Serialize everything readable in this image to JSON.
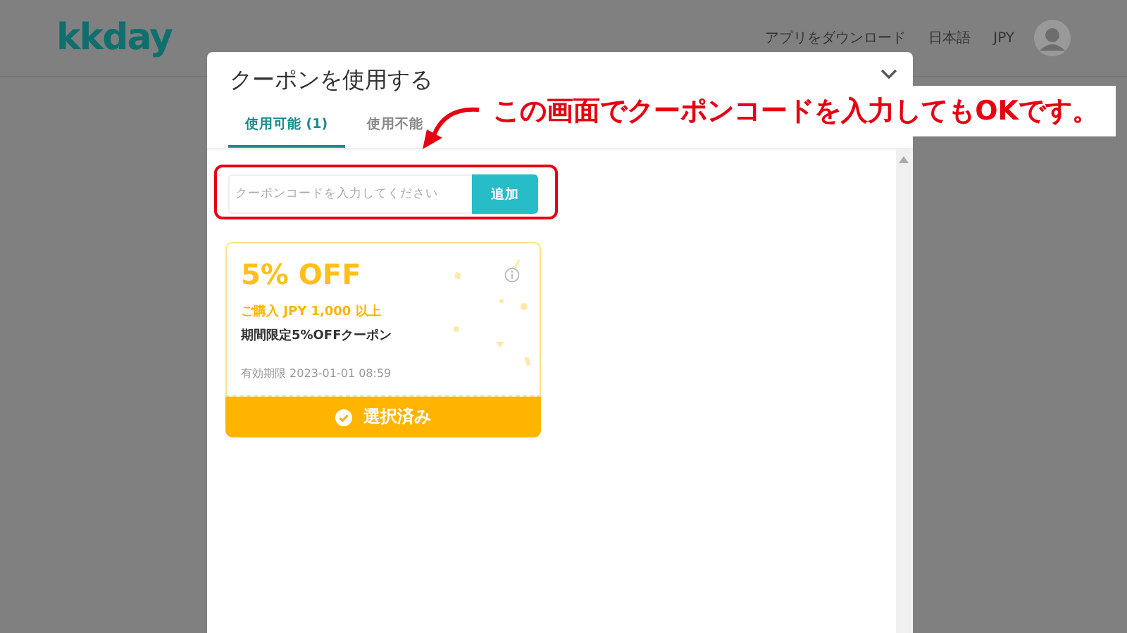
{
  "header": {
    "logo": "kkday",
    "links": [
      {
        "label": "アプリをダウンロード"
      },
      {
        "label": "日本語"
      },
      {
        "label": "JPY"
      }
    ]
  },
  "modal": {
    "title": "クーポンを使用する",
    "tabs": [
      {
        "label": "使用可能 (1)",
        "selected": true
      },
      {
        "label": "使用不能",
        "selected": false
      }
    ],
    "coupon_field": {
      "placeholder": "クーポンコードを入力してください"
    },
    "add_button": "追加",
    "coupons": [
      {
        "discount": "5% OFF",
        "condition": "ご購入 JPY 1,000 以上",
        "name": "期間限定5%OFFクーポン",
        "expiry": "有効期限 2023-01-01 08:59",
        "button": "選択済み",
        "selected": true
      }
    ]
  },
  "annotation": {
    "text": "この画面でクーポンコードを入力してもOKです。"
  }
}
